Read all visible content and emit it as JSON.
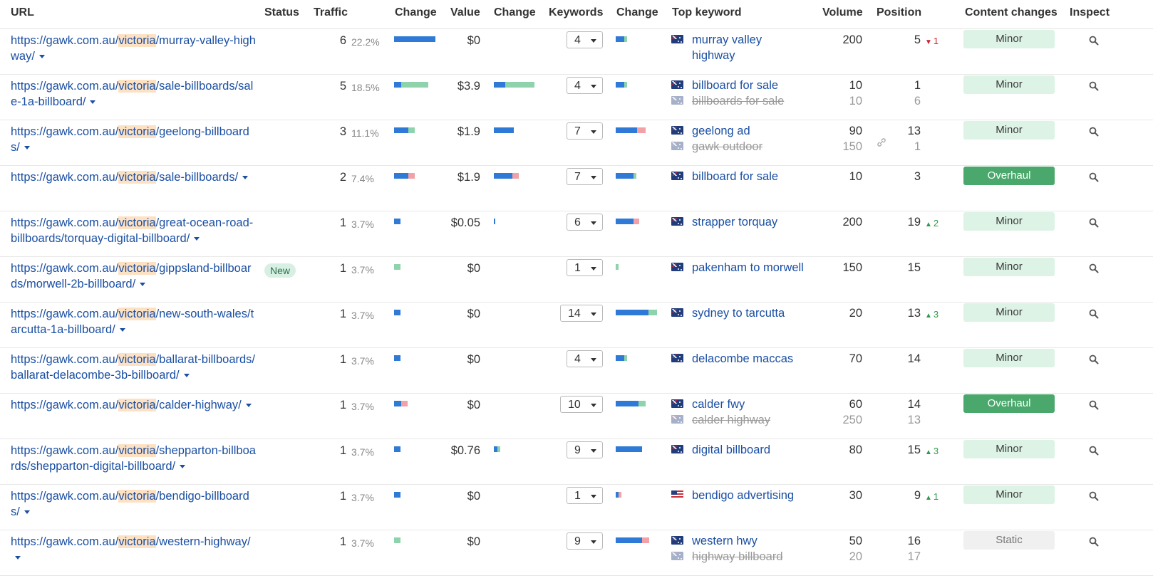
{
  "headers": {
    "url": "URL",
    "status": "Status",
    "traffic": "Traffic",
    "change1": "Change",
    "value": "Value",
    "change2": "Change",
    "keywords": "Keywords",
    "change3": "Change",
    "top_keyword": "Top keyword",
    "volume": "Volume",
    "position": "Position",
    "content_changes": "Content changes",
    "inspect": "Inspect"
  },
  "url_prefix": "https://gawk.com.au/",
  "url_highlight": "victoria",
  "colors": {
    "link": "#1a4fa3",
    "bar_blue": "#2e7ad6",
    "bar_green": "#8fd3ac",
    "bar_red": "#f2a1a6",
    "overhaul": "#4aa86c",
    "minor": "#ddf3e6"
  },
  "rows": [
    {
      "path": "/murray-valley-highway/",
      "status": "",
      "traffic": "6",
      "traffic_pct": "22.2%",
      "value": "$0",
      "keywords": "4",
      "kw1": "murray valley highway",
      "vol1": "200",
      "pos1": "5",
      "delta": "1",
      "delta_dir": "down",
      "kw2": "",
      "vol2": "",
      "pos2": "",
      "flag": "au",
      "content": "Minor"
    },
    {
      "path": "/sale-billboards/sale-1a-billboard/",
      "status": "",
      "traffic": "5",
      "traffic_pct": "18.5%",
      "value": "$3.9",
      "keywords": "4",
      "kw1": "billboard for sale",
      "vol1": "10",
      "pos1": "1",
      "delta": "",
      "delta_dir": "",
      "kw2": "billboards for sale",
      "vol2": "10",
      "pos2": "6",
      "flag": "au",
      "content": "Minor"
    },
    {
      "path": "/geelong-billboards/",
      "status": "",
      "traffic": "3",
      "traffic_pct": "11.1%",
      "value": "$1.9",
      "keywords": "7",
      "kw1": "geelong ad",
      "vol1": "90",
      "pos1": "13",
      "delta": "",
      "delta_dir": "",
      "kw2": "gawk outdoor",
      "vol2": "150",
      "pos2": "1",
      "flag": "au",
      "content": "Minor"
    },
    {
      "path": "/sale-billboards/",
      "status": "",
      "traffic": "2",
      "traffic_pct": "7.4%",
      "value": "$1.9",
      "keywords": "7",
      "kw1": "billboard for sale",
      "vol1": "10",
      "pos1": "3",
      "delta": "",
      "delta_dir": "",
      "kw2": "",
      "vol2": "",
      "pos2": "",
      "flag": "au",
      "content": "Overhaul"
    },
    {
      "path": "/great-ocean-road-billboards/torquay-digital-billboard/",
      "status": "",
      "traffic": "1",
      "traffic_pct": "3.7%",
      "value": "$0.05",
      "keywords": "6",
      "kw1": "strapper torquay",
      "vol1": "200",
      "pos1": "19",
      "delta": "2",
      "delta_dir": "up",
      "kw2": "",
      "vol2": "",
      "pos2": "",
      "flag": "au",
      "content": "Minor"
    },
    {
      "path": "/gippsland-billboards/morwell-2b-billboard/",
      "status": "New",
      "traffic": "1",
      "traffic_pct": "3.7%",
      "value": "$0",
      "keywords": "1",
      "kw1": "pakenham to morwell",
      "vol1": "150",
      "pos1": "15",
      "delta": "",
      "delta_dir": "",
      "kw2": "",
      "vol2": "",
      "pos2": "",
      "flag": "au",
      "content": "Minor"
    },
    {
      "path": "/new-south-wales/tarcutta-1a-billboard/",
      "status": "",
      "traffic": "1",
      "traffic_pct": "3.7%",
      "value": "$0",
      "keywords": "14",
      "kw1": "sydney to tarcutta",
      "vol1": "20",
      "pos1": "13",
      "delta": "3",
      "delta_dir": "up",
      "kw2": "",
      "vol2": "",
      "pos2": "",
      "flag": "au",
      "content": "Minor"
    },
    {
      "path": "/ballarat-billboards/ballarat-delacombe-3b-billboard/",
      "status": "",
      "traffic": "1",
      "traffic_pct": "3.7%",
      "value": "$0",
      "keywords": "4",
      "kw1": "delacombe maccas",
      "vol1": "70",
      "pos1": "14",
      "delta": "",
      "delta_dir": "",
      "kw2": "",
      "vol2": "",
      "pos2": "",
      "flag": "au",
      "content": "Minor"
    },
    {
      "path": "/calder-highway/",
      "status": "",
      "traffic": "1",
      "traffic_pct": "3.7%",
      "value": "$0",
      "keywords": "10",
      "kw1": "calder fwy",
      "vol1": "60",
      "pos1": "14",
      "delta": "",
      "delta_dir": "",
      "kw2": "calder highway",
      "vol2": "250",
      "pos2": "13",
      "flag": "au",
      "content": "Overhaul"
    },
    {
      "path": "/shepparton-billboards/shepparton-digital-billboard/",
      "status": "",
      "traffic": "1",
      "traffic_pct": "3.7%",
      "value": "$0.76",
      "keywords": "9",
      "kw1": "digital billboard",
      "vol1": "80",
      "pos1": "15",
      "delta": "3",
      "delta_dir": "up",
      "kw2": "",
      "vol2": "",
      "pos2": "",
      "flag": "au",
      "content": "Minor"
    },
    {
      "path": "/bendigo-billboards/",
      "status": "",
      "traffic": "1",
      "traffic_pct": "3.7%",
      "value": "$0",
      "keywords": "1",
      "kw1": "bendigo advertising",
      "vol1": "30",
      "pos1": "9",
      "delta": "1",
      "delta_dir": "up",
      "kw2": "",
      "vol2": "",
      "pos2": "",
      "flag": "us",
      "content": "Minor"
    },
    {
      "path": "/western-highway/",
      "status": "",
      "traffic": "1",
      "traffic_pct": "3.7%",
      "value": "$0",
      "keywords": "9",
      "kw1": "western hwy",
      "vol1": "50",
      "pos1": "16",
      "delta": "",
      "delta_dir": "",
      "kw2": "highway billboard",
      "vol2": "20",
      "pos2": "17",
      "flag": "au",
      "content": "Static"
    }
  ],
  "traffic_change_bars": [
    [
      [
        "b",
        58
      ]
    ],
    [
      [
        "b",
        10
      ],
      [
        "g",
        38
      ]
    ],
    [
      [
        "b",
        20
      ],
      [
        "g",
        9
      ]
    ],
    [
      [
        "b",
        20
      ],
      [
        "r",
        9
      ]
    ],
    [
      [
        "b",
        9
      ]
    ],
    [
      [
        "g",
        9
      ]
    ],
    [
      [
        "b",
        9
      ]
    ],
    [
      [
        "b",
        9
      ]
    ],
    [
      [
        "b",
        10
      ],
      [
        "r",
        9
      ]
    ],
    [
      [
        "b",
        9
      ]
    ],
    [
      [
        "b",
        9
      ]
    ],
    [
      [
        "g",
        9
      ]
    ]
  ],
  "value_change_bars": [
    [],
    [
      [
        "b",
        16
      ],
      [
        "g",
        41
      ]
    ],
    [
      [
        "b",
        28
      ]
    ],
    [
      [
        "b",
        26
      ],
      [
        "r",
        9
      ]
    ],
    [
      [
        "b",
        2
      ]
    ],
    [],
    [],
    [],
    [],
    [
      [
        "b",
        5
      ],
      [
        "g",
        4
      ]
    ],
    [],
    []
  ],
  "keyword_change_bars": [
    [
      [
        "b",
        12
      ],
      [
        "g",
        4
      ]
    ],
    [
      [
        "b",
        12
      ],
      [
        "g",
        4
      ]
    ],
    [
      [
        "b",
        30
      ],
      [
        "r",
        12
      ]
    ],
    [
      [
        "b",
        25
      ],
      [
        "g",
        4
      ]
    ],
    [
      [
        "b",
        25
      ],
      [
        "r",
        8
      ]
    ],
    [
      [
        "g",
        4
      ]
    ],
    [
      [
        "b",
        46
      ],
      [
        "g",
        12
      ]
    ],
    [
      [
        "b",
        12
      ],
      [
        "g",
        4
      ]
    ],
    [
      [
        "b",
        32
      ],
      [
        "g",
        10
      ]
    ],
    [
      [
        "b",
        37
      ]
    ],
    [
      [
        "b",
        4
      ],
      [
        "r",
        4
      ]
    ],
    [
      [
        "b",
        37
      ],
      [
        "r",
        10
      ]
    ]
  ]
}
